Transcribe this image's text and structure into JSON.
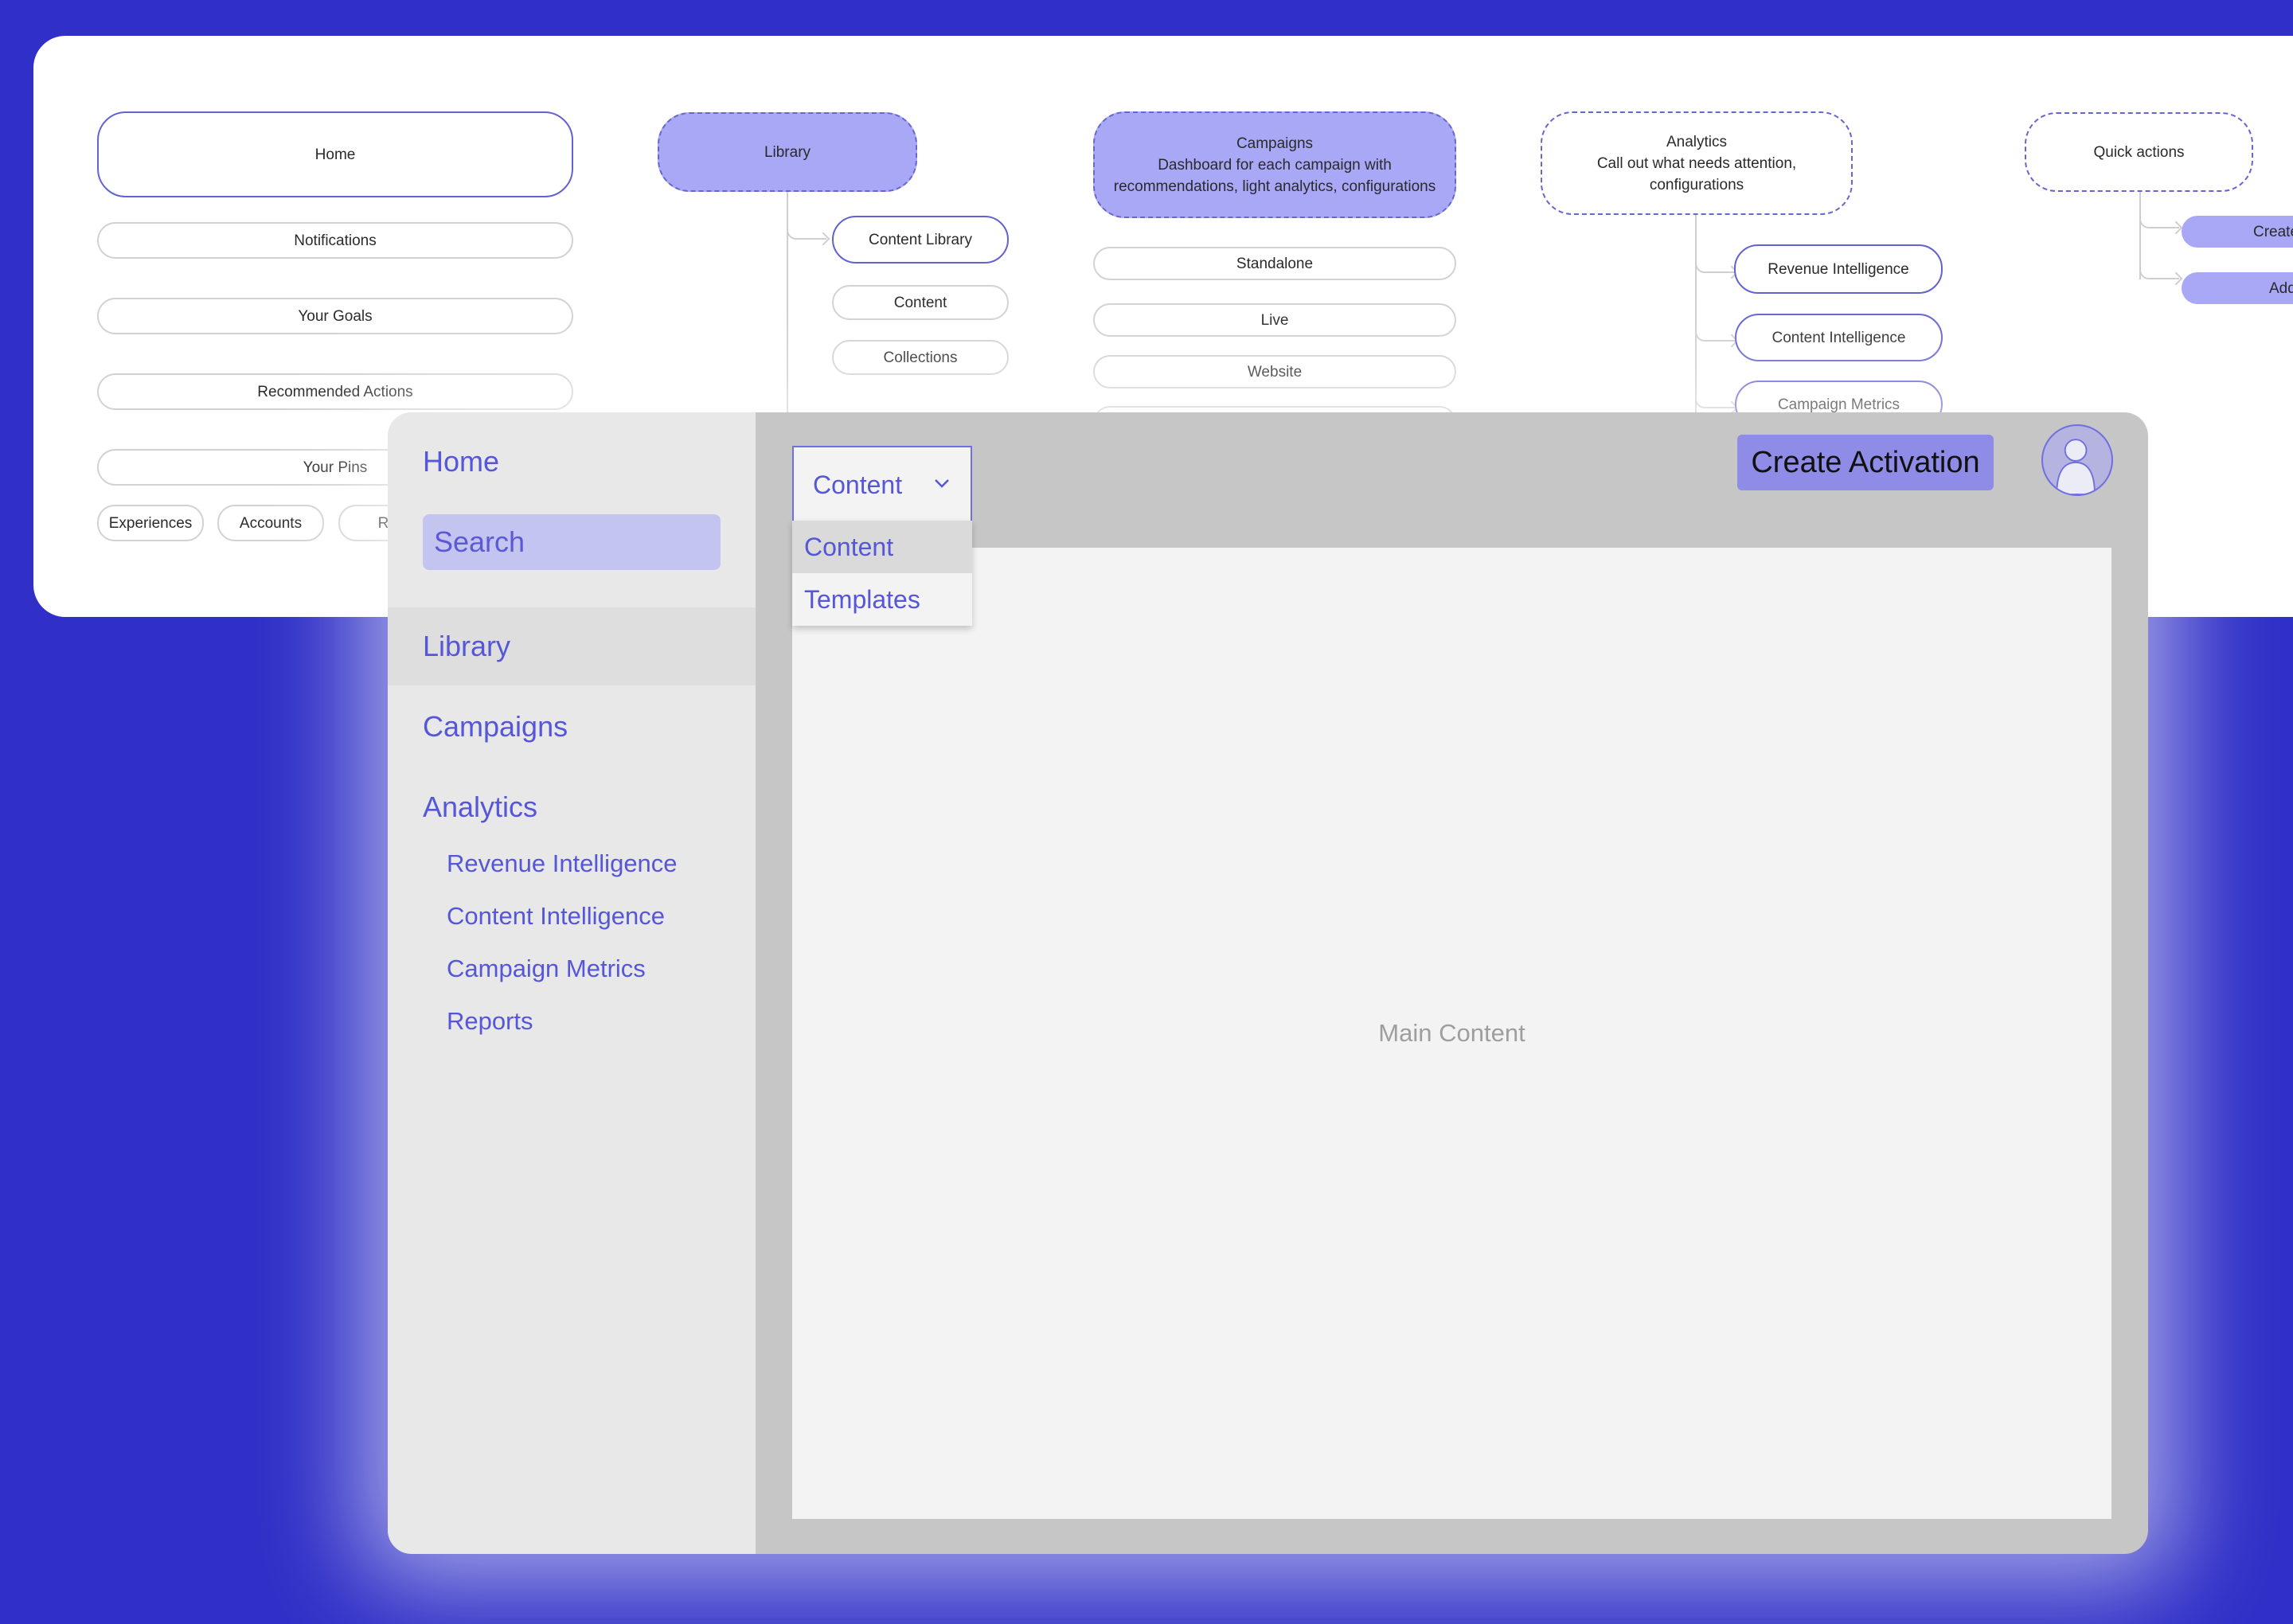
{
  "colors": {
    "background": "#3030C8",
    "accent": "#5656D8",
    "node_fill": "#A9A8F7",
    "button_fill": "#8E8CE6",
    "search_fill": "#C4C4F0"
  },
  "sitemap": {
    "home": {
      "title": "Home",
      "children": [
        "Notifications",
        "Your Goals",
        "Recommended Actions",
        "Your Pins"
      ],
      "chips": [
        "Experiences",
        "Accounts",
        "Rep"
      ]
    },
    "library": {
      "title": "Library",
      "children": [
        "Content Library",
        "Content",
        "Collections"
      ]
    },
    "campaigns": {
      "title": "Campaigns",
      "description": "Dashboard for each campaign with recommendations, light analytics, configurations",
      "children": [
        "Standalone",
        "Live",
        "Website"
      ]
    },
    "analytics": {
      "title": "Analytics",
      "description": "Call out what needs attention, configurations",
      "children": [
        "Revenue Intelligence",
        "Content Intelligence",
        "Campaign Metrics"
      ]
    },
    "quick_actions": {
      "title": "Quick actions",
      "children": [
        "Create",
        "Add"
      ]
    }
  },
  "app": {
    "sidebar": {
      "home": "Home",
      "search_placeholder": "Search",
      "items": [
        {
          "label": "Library",
          "active": true
        },
        {
          "label": "Campaigns"
        },
        {
          "label": "Analytics"
        }
      ],
      "analytics_sub": [
        "Revenue Intelligence",
        "Content Intelligence",
        "Campaign Metrics",
        "Reports"
      ]
    },
    "header": {
      "dropdown_value": "Content",
      "dropdown_options": [
        "Content",
        "Templates"
      ],
      "cta_label": "Create Activation"
    },
    "main": {
      "placeholder": "Main Content"
    }
  }
}
